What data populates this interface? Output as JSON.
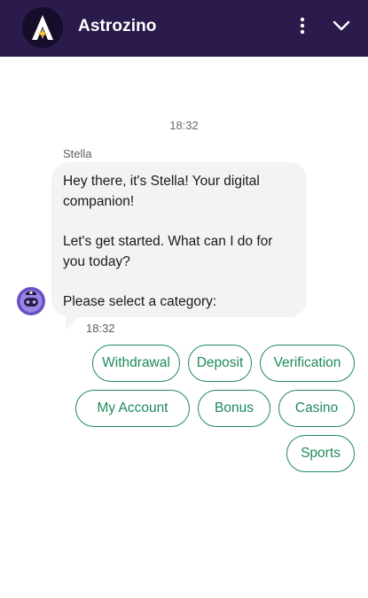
{
  "header": {
    "brand": "Astrozino",
    "logo_icon": "astrozino-a-star-logo",
    "menu_icon": "kebab-menu-icon",
    "collapse_icon": "chevron-down-icon",
    "bg_color": "#2b1a4c"
  },
  "chat": {
    "day_timestamp": "18:32",
    "message": {
      "sender": "Stella",
      "lines": [
        "Hey there, it's Stella! Your digital companion!",
        "Let's get started. What can I do for you today?",
        "Please select a category:"
      ],
      "timestamp": "18:32",
      "avatar_icon": "stella-robot-avatar"
    },
    "quick_replies": [
      "Withdrawal",
      "Deposit",
      "Verification",
      "My Account",
      "Bonus",
      "Casino",
      "Sports"
    ],
    "accent_color": "#1f8a5a"
  }
}
